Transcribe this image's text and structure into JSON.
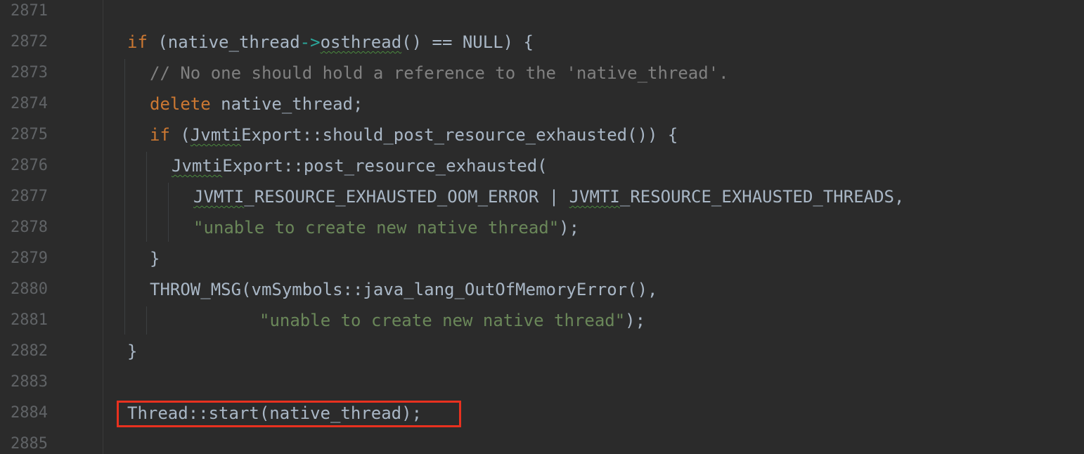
{
  "editor": {
    "line_numbers": [
      "2871",
      "2872",
      "2873",
      "2874",
      "2875",
      "2876",
      "2877",
      "2878",
      "2879",
      "2880",
      "2881",
      "2882",
      "2883",
      "2884",
      "2885"
    ],
    "lines": {
      "l2872": {
        "kw_if": "if",
        "a": " (native_thread",
        "arrow": "->",
        "b": "osthread",
        "c": "() == NULL) {"
      },
      "l2873": {
        "comment": "// No one should hold a reference to the 'native_thread'."
      },
      "l2874": {
        "kw_delete": "delete",
        "rest": " native_thread;"
      },
      "l2875": {
        "kw_if": "if",
        "a": " (",
        "b": "Jvmti",
        "c": "Export::should_post_resource_exhausted()) {"
      },
      "l2876": {
        "a": "Jvmti",
        "b": "Export::post_resource_exhausted("
      },
      "l2877": {
        "a": "JVMTI",
        "b": "_RESOURCE_EXHAUSTED_OOM_ERROR | ",
        "c": "JVMTI",
        "d": "_RESOURCE_EXHAUSTED_THREADS,"
      },
      "l2878": {
        "str": "\"unable to create new native thread\"",
        "rest": ");"
      },
      "l2879": {
        "text": "}"
      },
      "l2880": {
        "text": "THROW_MSG(vmSymbols::java_lang_OutOfMemoryError(),"
      },
      "l2881": {
        "str": "\"unable to create new native thread\"",
        "rest": ");"
      },
      "l2882": {
        "text": "}"
      },
      "l2884": {
        "text": "Thread::start(native_thread);"
      }
    }
  },
  "colors": {
    "background": "#2b2b2b",
    "keyword": "#cc7832",
    "string": "#6a8759",
    "comment": "#808080",
    "highlight_border": "#e8311f"
  }
}
